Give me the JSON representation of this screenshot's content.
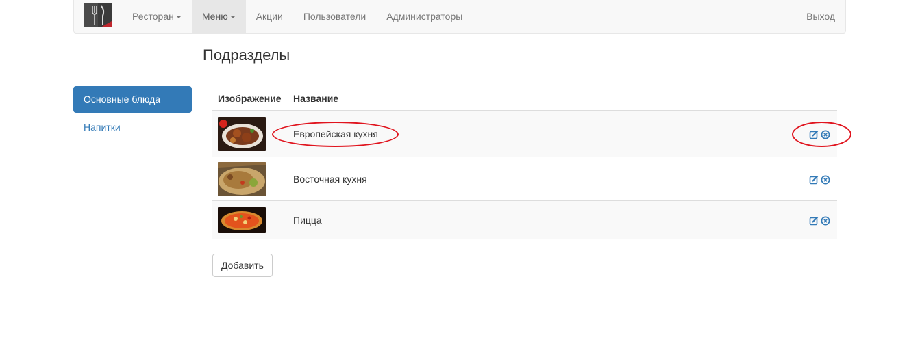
{
  "navbar": {
    "brand_icon": "fork-knife-logo",
    "items": [
      {
        "label": "Ресторан",
        "dropdown": true,
        "active": false
      },
      {
        "label": "Меню",
        "dropdown": true,
        "active": true
      },
      {
        "label": "Акции",
        "dropdown": false,
        "active": false
      },
      {
        "label": "Пользователи",
        "dropdown": false,
        "active": false
      },
      {
        "label": "Администраторы",
        "dropdown": false,
        "active": false
      }
    ],
    "logout_label": "Выход"
  },
  "page": {
    "title": "Подразделы"
  },
  "sidebar": {
    "items": [
      {
        "label": "Основные блюда",
        "active": true
      },
      {
        "label": "Напитки",
        "active": false
      }
    ]
  },
  "table": {
    "headers": {
      "image": "Изображение",
      "name": "Название"
    },
    "rows": [
      {
        "name": "Европейская кухня",
        "image_icon": "european-dish-photo"
      },
      {
        "name": "Восточная кухня",
        "image_icon": "pilaf-dish-photo"
      },
      {
        "name": "Пицца",
        "image_icon": "pizza-photo"
      }
    ],
    "row_actions": [
      "edit-icon",
      "delete-icon"
    ]
  },
  "buttons": {
    "add_label": "Добавить"
  },
  "colors": {
    "accent": "#337ab7",
    "annotation": "#e0141e",
    "navbar_bg": "#f8f8f8"
  }
}
